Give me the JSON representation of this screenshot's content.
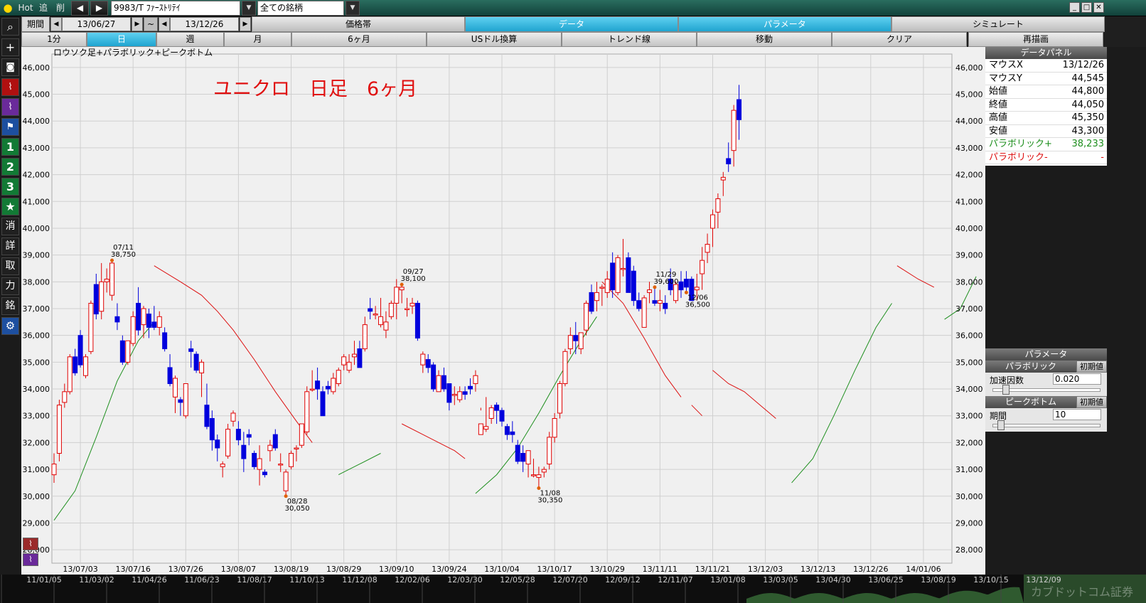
{
  "topbar": {
    "hot_label": "Hot",
    "tsui_label": "追",
    "sakujo_label": "削",
    "prev_label": "◀",
    "next_label": "▶",
    "symbol_value": "9983/T ﾌｧｰｽﾄﾘﾃｲ",
    "group_value": "全ての銘柄",
    "dropdown_arrow": "▼"
  },
  "row2": {
    "period_label": "期間",
    "start_date": "13/06/27",
    "tilde": "~",
    "end_date": "13/12/26",
    "tabs": [
      "価格帯",
      "データ",
      "パラメータ",
      "シミュレート"
    ]
  },
  "row3": {
    "tabs": [
      "1分",
      "日",
      "週",
      "月",
      "6ヶ月",
      "USドル換算",
      "トレンド線",
      "移動",
      "クリア",
      "再描画"
    ]
  },
  "left_toolbar": {
    "buttons": [
      "+",
      "1",
      "2",
      "3",
      "★",
      "消",
      "詳",
      "取",
      "力",
      "銘"
    ]
  },
  "chart": {
    "indicator_label": "ロウソク足+パラボリック+ピークボトム",
    "overlay_title": "ユニクロ　日足　6ヶ月"
  },
  "chart_data": {
    "type": "candlestick",
    "ylim": [
      27500,
      46500
    ],
    "yticks": [
      28000,
      29000,
      30000,
      31000,
      32000,
      33000,
      34000,
      35000,
      36000,
      37000,
      38000,
      39000,
      40000,
      41000,
      42000,
      43000,
      44000,
      45000,
      46000
    ],
    "ytick_labels": [
      "28,000",
      "29,000",
      "30,000",
      "31,000",
      "32,000",
      "33,000",
      "34,000",
      "35,000",
      "36,000",
      "37,000",
      "38,000",
      "39,000",
      "40,000",
      "41,000",
      "42,000",
      "43,000",
      "44,000",
      "45,000",
      "46,000"
    ],
    "xtick_labels": [
      "13/07/03",
      "13/07/16",
      "13/07/26",
      "13/08/07",
      "13/08/19",
      "13/08/29",
      "13/09/10",
      "13/09/24",
      "13/10/04",
      "13/10/17",
      "13/10/29",
      "13/11/11",
      "13/11/21",
      "13/12/03",
      "13/12/13",
      "13/12/26",
      "14/01/06"
    ],
    "xtick_index": [
      5,
      15,
      25,
      35,
      45,
      55,
      65,
      75,
      85,
      95,
      105,
      115,
      125,
      135,
      145,
      155,
      165
    ],
    "candles": [
      [
        30800,
        31600,
        30500,
        31200
      ],
      [
        31600,
        33600,
        31300,
        33400
      ],
      [
        33500,
        34200,
        33300,
        33900
      ],
      [
        33900,
        35300,
        33800,
        35200
      ],
      [
        35200,
        35500,
        34500,
        34600
      ],
      [
        36000,
        36200,
        34800,
        34900
      ],
      [
        34500,
        35300,
        34400,
        35200
      ],
      [
        35400,
        37300,
        35300,
        37200
      ],
      [
        37900,
        38300,
        36600,
        36800
      ],
      [
        36900,
        38700,
        36600,
        38000
      ],
      [
        38000,
        38500,
        37600,
        38100
      ],
      [
        37500,
        38800,
        37300,
        38700
      ],
      [
        36700,
        37200,
        36200,
        36500
      ],
      [
        35800,
        36000,
        34900,
        35000
      ],
      [
        35000,
        35800,
        34900,
        35800
      ],
      [
        35700,
        36900,
        35600,
        36700
      ],
      [
        37200,
        37800,
        36000,
        36200
      ],
      [
        36400,
        37100,
        35900,
        37000
      ],
      [
        36800,
        37000,
        35900,
        36300
      ],
      [
        36500,
        37100,
        36200,
        36300
      ],
      [
        36300,
        36900,
        36000,
        36700
      ],
      [
        36100,
        36300,
        35400,
        35500
      ],
      [
        34800,
        35300,
        34100,
        34200
      ],
      [
        33700,
        34500,
        33100,
        34400
      ],
      [
        33600,
        33700,
        33000,
        33500
      ],
      [
        33000,
        34200,
        32900,
        34200
      ],
      [
        35500,
        35800,
        34800,
        35400
      ],
      [
        35300,
        35400,
        34600,
        34700
      ],
      [
        34600,
        35100,
        33700,
        35000
      ],
      [
        33400,
        34200,
        32500,
        32600
      ],
      [
        32900,
        33200,
        31700,
        32100
      ],
      [
        32100,
        32300,
        31300,
        31800
      ],
      [
        31100,
        31300,
        30700,
        31200
      ],
      [
        31500,
        32700,
        31400,
        32500
      ],
      [
        32800,
        33200,
        32600,
        33100
      ],
      [
        32500,
        32800,
        31900,
        32100
      ],
      [
        31900,
        32400,
        30900,
        31400
      ],
      [
        32300,
        32500,
        31900,
        32200
      ],
      [
        31600,
        31700,
        31000,
        31100
      ],
      [
        31000,
        31900,
        30400,
        31400
      ],
      [
        30900,
        31000,
        30700,
        30800
      ],
      [
        31700,
        32100,
        31300,
        31900
      ],
      [
        32300,
        32500,
        31700,
        31800
      ],
      [
        31200,
        31600,
        30900,
        31200
      ],
      [
        30200,
        31000,
        30000,
        30900
      ],
      [
        31100,
        31700,
        31000,
        31600
      ],
      [
        31800,
        31900,
        31300,
        31800
      ],
      [
        31900,
        32700,
        31800,
        32700
      ],
      [
        32400,
        34100,
        32300,
        33900
      ],
      [
        34000,
        34700,
        33900,
        34000
      ],
      [
        34300,
        34800,
        33600,
        34000
      ],
      [
        33900,
        34100,
        33000,
        33000
      ],
      [
        34100,
        34300,
        33800,
        34000
      ],
      [
        33900,
        34600,
        33800,
        34400
      ],
      [
        34200,
        34800,
        34100,
        34700
      ],
      [
        34900,
        35300,
        34700,
        35200
      ],
      [
        34700,
        35300,
        34600,
        35000
      ],
      [
        35200,
        35800,
        34900,
        35300
      ],
      [
        35500,
        35800,
        34800,
        34800
      ],
      [
        35500,
        36700,
        35400,
        36400
      ],
      [
        37000,
        37400,
        36600,
        36900
      ],
      [
        36800,
        37100,
        36600,
        36800
      ],
      [
        36400,
        37400,
        36300,
        36700
      ],
      [
        36200,
        36900,
        35900,
        36500
      ],
      [
        36700,
        37300,
        36600,
        37200
      ],
      [
        37200,
        38100,
        36600,
        37800
      ],
      [
        37700,
        37900,
        37200,
        37800
      ],
      [
        37000,
        37400,
        36700,
        37000
      ],
      [
        37100,
        37400,
        36800,
        37200
      ],
      [
        37200,
        37300,
        35800,
        35900
      ],
      [
        34900,
        35400,
        34600,
        35300
      ],
      [
        35100,
        35300,
        34600,
        34800
      ],
      [
        34900,
        35000,
        33900,
        34000
      ],
      [
        33900,
        34700,
        33900,
        34500
      ],
      [
        34500,
        34800,
        33900,
        34000
      ],
      [
        34200,
        34200,
        33200,
        33500
      ],
      [
        33800,
        34100,
        33400,
        33800
      ],
      [
        33600,
        34100,
        33500,
        33900
      ],
      [
        33900,
        34100,
        33600,
        33800
      ],
      [
        34100,
        34400,
        33800,
        34000
      ],
      [
        34200,
        34700,
        33900,
        34500
      ],
      [
        32300,
        33300,
        33200,
        32700
      ],
      [
        32500,
        33700,
        32400,
        32600
      ],
      [
        32900,
        33400,
        32700,
        33300
      ],
      [
        33400,
        33500,
        32700,
        33200
      ],
      [
        33200,
        33300,
        32600,
        32800
      ],
      [
        32600,
        32700,
        32100,
        32300
      ],
      [
        32400,
        32800,
        32000,
        32300
      ],
      [
        31900,
        32100,
        31200,
        31300
      ],
      [
        31600,
        31900,
        30900,
        31300
      ],
      [
        31200,
        31700,
        30700,
        31700
      ],
      [
        30800,
        31400,
        30700,
        30800
      ],
      [
        30700,
        31100,
        30300,
        30800
      ],
      [
        30900,
        31100,
        30700,
        31000
      ],
      [
        31200,
        32400,
        31000,
        32200
      ],
      [
        32200,
        33100,
        32000,
        32900
      ],
      [
        33100,
        34300,
        32900,
        34200
      ],
      [
        34200,
        35500,
        34100,
        35400
      ],
      [
        35500,
        36300,
        35300,
        36000
      ],
      [
        36000,
        36500,
        35300,
        35800
      ],
      [
        35500,
        36100,
        35300,
        36100
      ],
      [
        36200,
        37300,
        36000,
        37200
      ],
      [
        37600,
        37900,
        36800,
        36900
      ],
      [
        37300,
        38000,
        36900,
        37600
      ],
      [
        37800,
        37900,
        37100,
        37800
      ],
      [
        37600,
        38400,
        37400,
        38100
      ],
      [
        38700,
        39100,
        37400,
        37700
      ],
      [
        37600,
        39000,
        37500,
        38900
      ],
      [
        38500,
        39600,
        38200,
        38500
      ],
      [
        38900,
        39100,
        37700,
        37600
      ],
      [
        38400,
        38600,
        37100,
        37300
      ],
      [
        37300,
        37600,
        36900,
        37000
      ],
      [
        36300,
        37500,
        36300,
        37400
      ],
      [
        37600,
        38000,
        37200,
        37700
      ],
      [
        37300,
        37800,
        37100,
        37200
      ],
      [
        37200,
        37700,
        36900,
        37300
      ],
      [
        37200,
        37500,
        36800,
        37000
      ],
      [
        38100,
        38500,
        37500,
        37700
      ],
      [
        37300,
        38000,
        37200,
        37900
      ],
      [
        38000,
        38400,
        37400,
        37700
      ],
      [
        38100,
        38400,
        37600,
        37800
      ],
      [
        38100,
        38200,
        37300,
        37300
      ],
      [
        37700,
        38300,
        37300,
        37800
      ],
      [
        38300,
        39300,
        37700,
        38800
      ],
      [
        39100,
        39800,
        38700,
        39400
      ],
      [
        40000,
        40700,
        39300,
        40500
      ],
      [
        40600,
        41300,
        40000,
        41100
      ],
      [
        41800,
        42100,
        41200,
        41900
      ],
      [
        42600,
        43200,
        42100,
        42400
      ],
      [
        42900,
        44600,
        42300,
        44400
      ],
      [
        44800,
        45350,
        43300,
        44050
      ]
    ],
    "parabolic": [
      [
        [
          0,
          29100
        ],
        [
          4,
          30200
        ],
        [
          8,
          32200
        ],
        [
          12,
          34300
        ],
        [
          16,
          35800
        ],
        [
          19,
          36500
        ]
      ],
      [
        [
          19,
          38600
        ],
        [
          24,
          38000
        ],
        [
          28,
          37500
        ],
        [
          31,
          36900
        ],
        [
          34,
          36200
        ],
        [
          38,
          35100
        ],
        [
          42,
          33900
        ],
        [
          46,
          32800
        ],
        [
          49,
          32000
        ]
      ],
      [
        [
          54,
          30800
        ],
        [
          58,
          31200
        ],
        [
          62,
          31600
        ]
      ],
      [
        [
          66,
          32700
        ],
        [
          70,
          32300
        ],
        [
          73,
          32000
        ],
        [
          76,
          31700
        ],
        [
          78,
          31400
        ]
      ],
      [
        [
          80,
          30100
        ],
        [
          84,
          30800
        ],
        [
          88,
          31800
        ],
        [
          92,
          33100
        ],
        [
          96,
          34500
        ],
        [
          100,
          35800
        ],
        [
          103,
          36700
        ]
      ],
      [
        [
          104,
          38000
        ],
        [
          108,
          37200
        ],
        [
          112,
          35900
        ],
        [
          116,
          34500
        ],
        [
          119,
          33700
        ]
      ],
      [
        [
          121,
          33400
        ],
        [
          123,
          33000
        ]
      ],
      [
        [
          125,
          34700
        ],
        [
          128,
          34200
        ],
        [
          131,
          33900
        ],
        [
          134,
          33400
        ],
        [
          137,
          32900
        ]
      ],
      [
        [
          140,
          30500
        ],
        [
          144,
          31400
        ],
        [
          148,
          33000
        ],
        [
          152,
          34700
        ],
        [
          156,
          36300
        ],
        [
          159,
          37200
        ]
      ],
      [
        [
          160,
          38600
        ],
        [
          164,
          38100
        ],
        [
          167,
          37800
        ]
      ],
      [
        [
          169,
          36600
        ],
        [
          172,
          37000
        ],
        [
          175,
          38200
        ]
      ]
    ],
    "peak_bottom": [
      {
        "index": 11,
        "date": "07/11",
        "price": "38,750",
        "kind": "peak"
      },
      {
        "index": 44,
        "date": "08/28",
        "price": "30,050",
        "kind": "bottom"
      },
      {
        "index": 66,
        "date": "09/27",
        "price": "38,100",
        "kind": "peak"
      },
      {
        "index": 92,
        "date": "11/08",
        "price": "30,350",
        "kind": "bottom"
      },
      {
        "index": 114,
        "date": "11/29",
        "price": "39,600",
        "kind": "peak"
      },
      {
        "index": 120,
        "date": "12/06",
        "price": "36,500",
        "kind": "bottom"
      }
    ],
    "up_color": "#e00000",
    "down_color": "#0000dd",
    "sar_up_color": "#1e8f1e",
    "sar_down_color": "#dd1111"
  },
  "data_panel": {
    "header": "データパネル",
    "rows": [
      {
        "key": "マウスX",
        "value": "13/12/26"
      },
      {
        "key": "マウスY",
        "value": "44,545"
      },
      {
        "key": "始値",
        "value": "44,800"
      },
      {
        "key": "終値",
        "value": "44,050"
      },
      {
        "key": "高値",
        "value": "45,350"
      },
      {
        "key": "安値",
        "value": "43,300"
      },
      {
        "key": "パラボリック+",
        "value": "38,233"
      },
      {
        "key": "パラボリック-",
        "value": "-"
      }
    ]
  },
  "param_panel": {
    "header": "パラメータ",
    "parabolic_label": "パラボリック",
    "reset_label": "初期値",
    "accel_label": "加速因数",
    "accel_value": "0.020",
    "accel_slider": 0.1,
    "peakbottom_label": "ピークボトム",
    "period_label": "期間",
    "period_value": "10",
    "period_slider": 0.05
  },
  "bottom": {
    "dates": [
      "11/01/05",
      "11/03/02",
      "11/04/26",
      "11/06/23",
      "11/08/17",
      "11/10/13",
      "11/12/08",
      "12/02/06",
      "12/03/30",
      "12/05/28",
      "12/07/20",
      "12/09/12",
      "12/11/07",
      "13/01/08",
      "13/03/05",
      "13/04/30",
      "13/06/25",
      "13/08/19",
      "13/10/15",
      "13/12/09"
    ],
    "watermark": "カブドットコム証券"
  }
}
